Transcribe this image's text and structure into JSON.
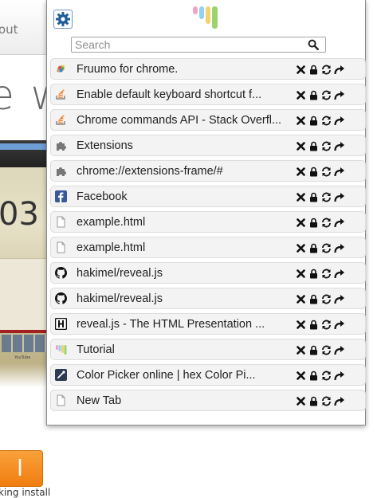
{
  "background_page": {
    "nav_text": "out",
    "headline_fragment": "e w",
    "screenshot_number": "03",
    "screenshot_caption": "YouTube",
    "install_button_label": "l",
    "install_note": "king install"
  },
  "popup": {
    "settings_icon": "gear-icon",
    "logo_colors": [
      "#f4a3c8",
      "#8fd3f2",
      "#f3d36b",
      "#9cd36e"
    ],
    "search": {
      "placeholder": "Search",
      "value": "",
      "icon": "search-icon"
    },
    "row_actions": [
      "close-icon",
      "lock-icon",
      "reload-icon",
      "redirect-icon"
    ],
    "tabs": [
      {
        "title": "Fruumo for chrome.",
        "favicon": "fruumo-icon"
      },
      {
        "title": "Enable default keyboard shortcut f...",
        "favicon": "stackoverflow-icon"
      },
      {
        "title": "Chrome commands API - Stack Overfl...",
        "favicon": "stackoverflow-icon"
      },
      {
        "title": "Extensions",
        "favicon": "puzzle-icon"
      },
      {
        "title": "chrome://extensions-frame/#",
        "favicon": "puzzle-icon"
      },
      {
        "title": "Facebook",
        "favicon": "facebook-icon"
      },
      {
        "title": "example.html",
        "favicon": "page-icon"
      },
      {
        "title": "example.html",
        "favicon": "page-icon"
      },
      {
        "title": "hakimel/reveal.js",
        "favicon": "github-icon"
      },
      {
        "title": "hakimel/reveal.js",
        "favicon": "github-icon"
      },
      {
        "title": "reveal.js - The HTML Presentation ...",
        "favicon": "reveal-h-icon"
      },
      {
        "title": "Tutorial",
        "favicon": "tutorial-icon"
      },
      {
        "title": "Color Picker online | hex Color Pi...",
        "favicon": "colorpicker-icon"
      },
      {
        "title": "New Tab",
        "favicon": "page-icon"
      }
    ]
  }
}
